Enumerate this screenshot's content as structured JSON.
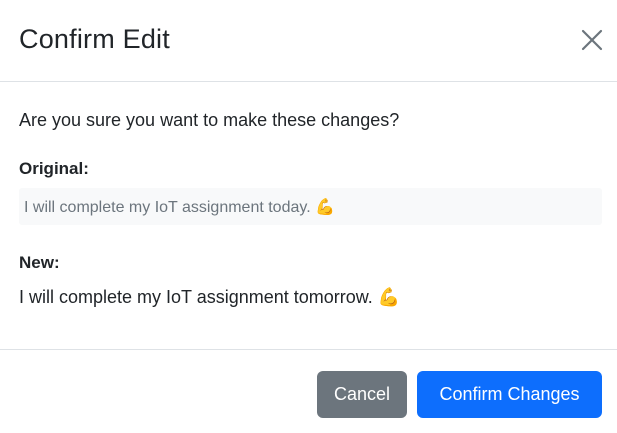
{
  "modal": {
    "title": "Confirm Edit",
    "prompt": "Are you sure you want to make these changes?",
    "original_label": "Original:",
    "original_text": "I will complete my IoT assignment today. 💪",
    "new_label": "New:",
    "new_text": "I will complete my IoT assignment tomorrow. 💪",
    "close_icon": "close-icon"
  },
  "footer": {
    "cancel_label": "Cancel",
    "confirm_label": "Confirm Changes"
  },
  "colors": {
    "primary": "#0d6efd",
    "secondary": "#6c757d",
    "original_bg": "#f8f9fa"
  }
}
